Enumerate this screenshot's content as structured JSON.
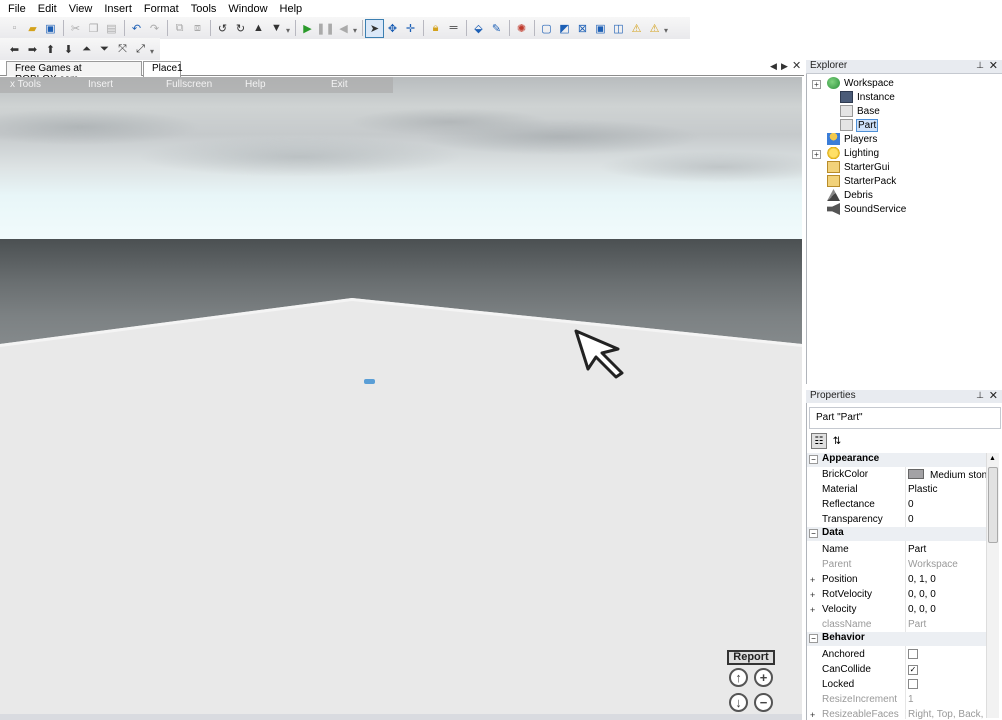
{
  "menubar": {
    "items": [
      "File",
      "Edit",
      "View",
      "Insert",
      "Format",
      "Tools",
      "Window",
      "Help"
    ]
  },
  "toolbar1_icons": [
    "new-icon",
    "open-icon",
    "save-icon",
    "cut-icon",
    "copy-icon",
    "paste-icon",
    "undo-icon",
    "redo-icon",
    "group-icon",
    "ungroup-icon",
    "rotate-left-icon",
    "rotate-right-icon",
    "move-up-icon",
    "move-down-icon",
    "play-icon",
    "pause-icon",
    "stop-icon",
    "select-icon",
    "move-icon",
    "resize-icon",
    "lock-icon",
    "surface-icon",
    "paint-icon",
    "dropper-icon",
    "joint-icon",
    "layer1-icon",
    "layer2-icon",
    "layer3-icon",
    "layer4-icon",
    "layer5-icon",
    "warning-icon",
    "warning-icon-2"
  ],
  "tabs": {
    "tab1": "Free Games at ROBLOX.com",
    "tab2": "Place1"
  },
  "game_gui": {
    "tools": "x Tools",
    "insert": "Insert",
    "fullscreen": "Fullscreen",
    "help": "Help",
    "exit": "Exit",
    "report": "Report"
  },
  "explorer": {
    "title": "Explorer",
    "items": [
      {
        "label": "Workspace"
      },
      {
        "label": "Instance"
      },
      {
        "label": "Base"
      },
      {
        "label": "Part"
      },
      {
        "label": "Players"
      },
      {
        "label": "Lighting"
      },
      {
        "label": "StarterGui"
      },
      {
        "label": "StarterPack"
      },
      {
        "label": "Debris"
      },
      {
        "label": "SoundService"
      }
    ]
  },
  "properties": {
    "title": "Properties",
    "object": "Part \"Part\"",
    "categories": {
      "appearance": "Appearance",
      "data": "Data",
      "behavior": "Behavior"
    },
    "rows": {
      "brickcolor": {
        "name": "BrickColor",
        "value": "Medium stone grey",
        "swatch": "#a3a2a5"
      },
      "material": {
        "name": "Material",
        "value": "Plastic"
      },
      "reflectance": {
        "name": "Reflectance",
        "value": "0"
      },
      "transparency": {
        "name": "Transparency",
        "value": "0"
      },
      "name": {
        "name": "Name",
        "value": "Part"
      },
      "parent": {
        "name": "Parent",
        "value": "Workspace"
      },
      "position": {
        "name": "Position",
        "value": "0, 1, 0"
      },
      "rotvelocity": {
        "name": "RotVelocity",
        "value": "0, 0, 0"
      },
      "velocity": {
        "name": "Velocity",
        "value": "0, 0, 0"
      },
      "classname": {
        "name": "className",
        "value": "Part"
      },
      "anchored": {
        "name": "Anchored",
        "checked": false
      },
      "cancollide": {
        "name": "CanCollide",
        "checked": true
      },
      "locked": {
        "name": "Locked",
        "checked": false
      },
      "resizeincrement": {
        "name": "ResizeIncrement",
        "value": "1"
      },
      "resizeablefaces": {
        "name": "ResizeableFaces",
        "value": "Right, Top, Back, L"
      }
    }
  },
  "colors": {
    "selection": "#cfe2fa",
    "panel_header": "#e8ebf0",
    "floor": "#e6e6e6",
    "wall": "#6a6f71"
  }
}
